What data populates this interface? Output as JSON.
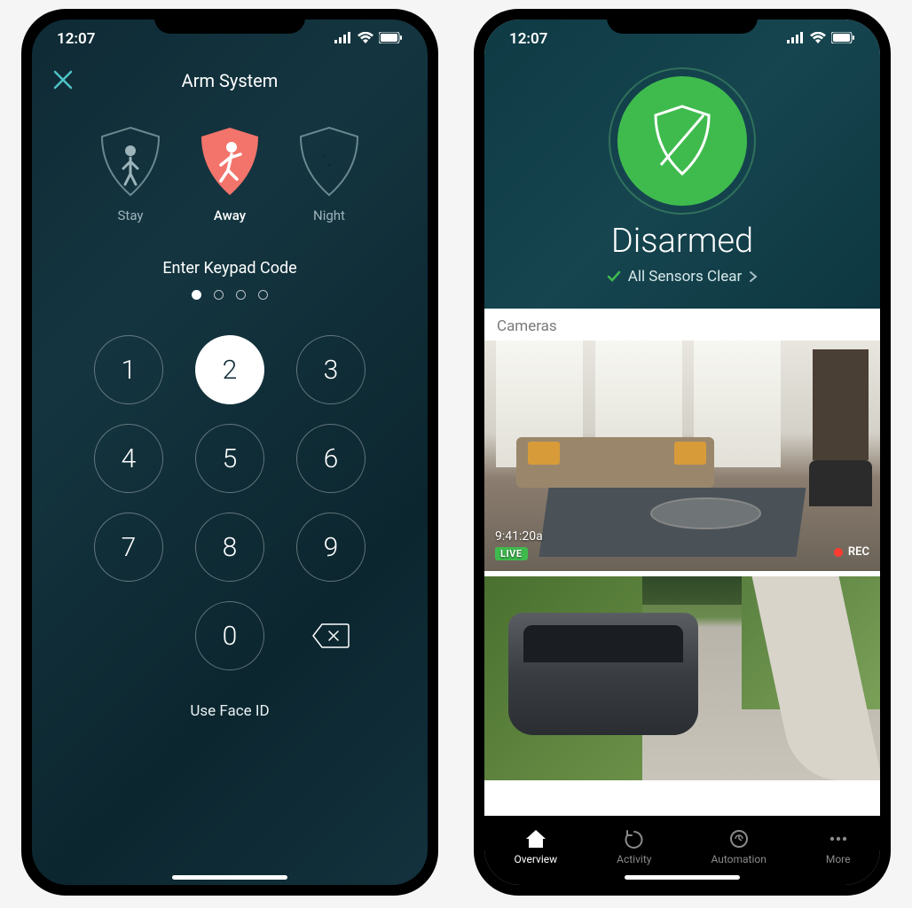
{
  "statusBar": {
    "time": "12:07"
  },
  "armScreen": {
    "title": "Arm System",
    "modes": [
      {
        "label": "Stay",
        "active": false
      },
      {
        "label": "Away",
        "active": true
      },
      {
        "label": "Night",
        "active": false
      }
    ],
    "prompt": "Enter Keypad Code",
    "pinLength": 4,
    "pinEntered": 1,
    "keys": [
      "1",
      "2",
      "3",
      "4",
      "5",
      "6",
      "7",
      "8",
      "9",
      "",
      "0",
      "del"
    ],
    "activeKey": "2",
    "faceIdLabel": "Use Face ID"
  },
  "homeScreen": {
    "statusTitle": "Disarmed",
    "sensorStatus": "All Sensors Clear",
    "camerasLabel": "Cameras",
    "feeds": [
      {
        "timestamp": "9:41:20a",
        "liveLabel": "LIVE",
        "recLabel": "REC"
      },
      {}
    ],
    "tabs": [
      {
        "label": "Overview",
        "active": true
      },
      {
        "label": "Activity",
        "active": false
      },
      {
        "label": "Automation",
        "active": false
      },
      {
        "label": "More",
        "active": false
      }
    ]
  },
  "colors": {
    "accentTeal": "#4fc3c7",
    "accentGreen": "#3fbb4e",
    "accentCoral": "#f2746b"
  }
}
